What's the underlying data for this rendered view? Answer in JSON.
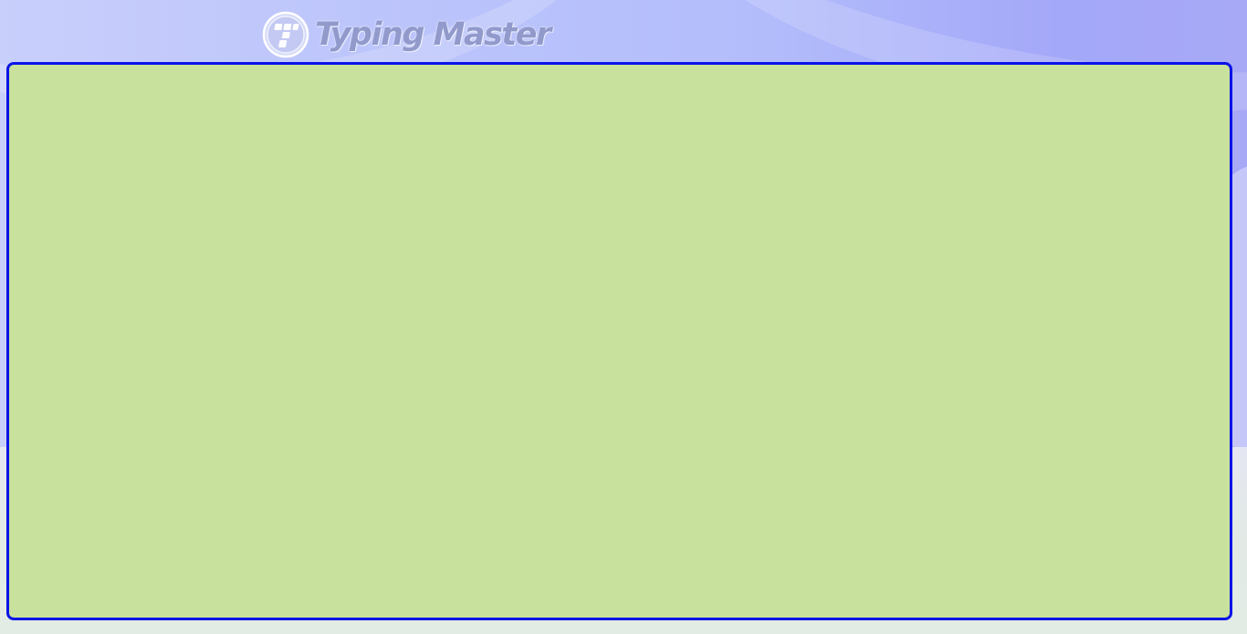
{
  "app": {
    "logo_text": "Typing Master",
    "logo_icon": "typing-master-logo-icon"
  },
  "colors": {
    "panel_background": "#c8e19c",
    "panel_border": "#0a14e6",
    "header_gradient_start": "#c9cffb",
    "header_gradient_end": "#a7a9f6",
    "footer_background": "#e2ece4",
    "logo_text": "#919acb"
  },
  "content_panel": {
    "state": "empty"
  }
}
